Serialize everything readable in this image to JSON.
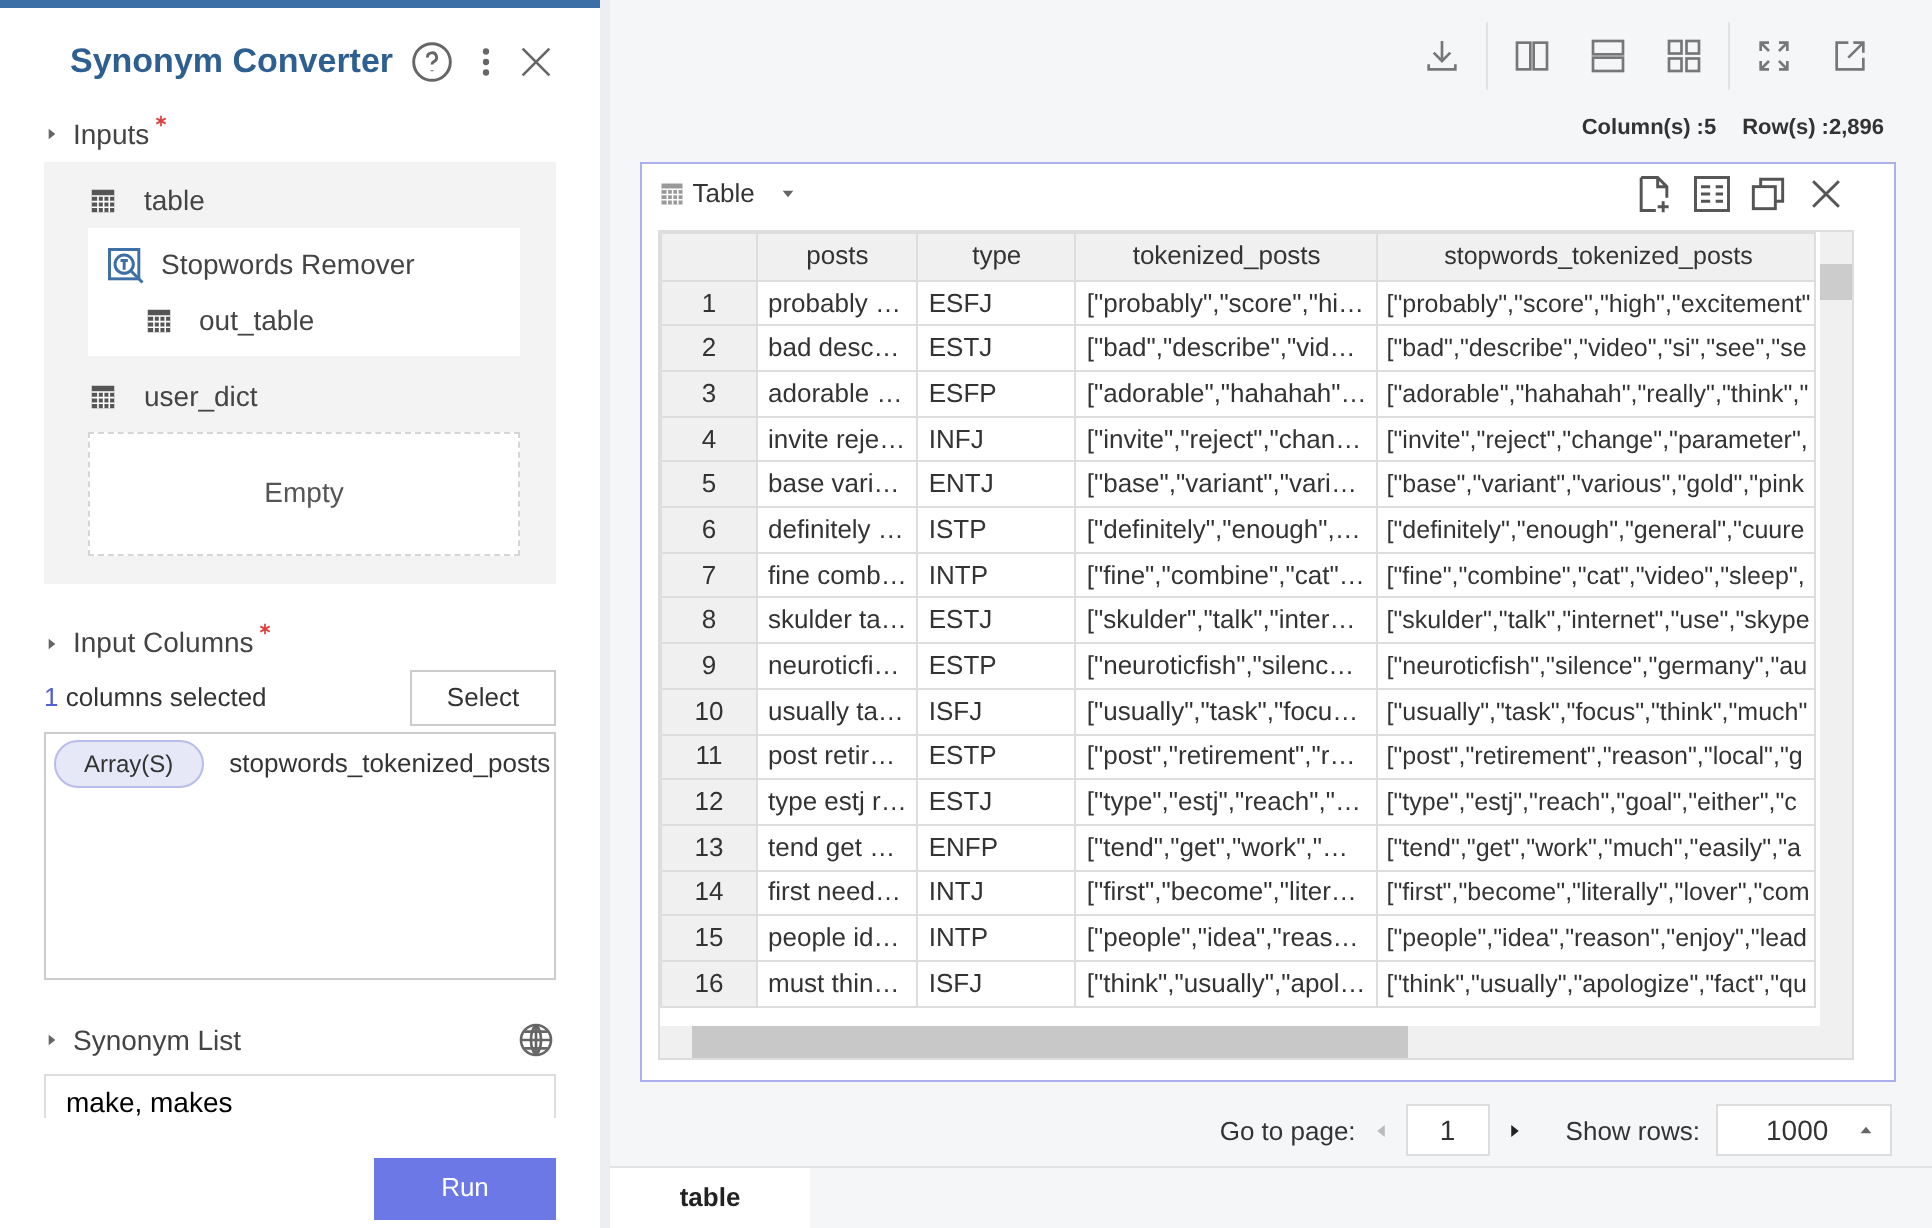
{
  "panel": {
    "title": "Synonym Converter",
    "inputs": {
      "label": "Inputs",
      "required": true,
      "expanded": false,
      "items": [
        {
          "label": "table",
          "children": [
            {
              "kind": "operator",
              "label": "Stopwords Remover",
              "children": [
                {
                  "kind": "table",
                  "label": "out_table"
                }
              ]
            }
          ]
        },
        {
          "label": "user_dict",
          "empty_text": "Empty"
        }
      ]
    },
    "input_columns": {
      "label": "Input Columns",
      "required": true,
      "expanded": false,
      "count": "1",
      "count_text": "columns selected",
      "button": "Select",
      "columns": [
        {
          "type": "Array(S)",
          "name": "stopwords_tokenized_posts"
        }
      ]
    },
    "synonym_list": {
      "label": "Synonym List",
      "required": false,
      "expanded": false,
      "value": "make, makes"
    },
    "run_button": "Run"
  },
  "stats": {
    "columns": "Column(s) :5",
    "rows": "Row(s) :2,896"
  },
  "table_card": {
    "title": "Table",
    "columns": [
      "",
      "posts",
      "type",
      "tokenized_posts",
      "stopwords_tokenized_posts"
    ],
    "rows": [
      [
        "1",
        "probably …",
        "ESFJ",
        "[\"probably\",\"score\",\"hi…",
        "[\"probably\",\"score\",\"high\",\"excitement\""
      ],
      [
        "2",
        "bad desc…",
        "ESTJ",
        "[\"bad\",\"describe\",\"vid…",
        "[\"bad\",\"describe\",\"video\",\"si\",\"see\",\"se"
      ],
      [
        "3",
        "adorable …",
        "ESFP",
        "[\"adorable\",\"hahahah\"…",
        "[\"adorable\",\"hahahah\",\"really\",\"think\",\""
      ],
      [
        "4",
        "invite reje…",
        "INFJ",
        "[\"invite\",\"reject\",\"chan…",
        "[\"invite\",\"reject\",\"change\",\"parameter\","
      ],
      [
        "5",
        "base vari…",
        "ENTJ",
        "[\"base\",\"variant\",\"vari…",
        "[\"base\",\"variant\",\"various\",\"gold\",\"pink"
      ],
      [
        "6",
        "definitely …",
        "ISTP",
        "[\"definitely\",\"enough\",…",
        "[\"definitely\",\"enough\",\"general\",\"cuure"
      ],
      [
        "7",
        "fine comb…",
        "INTP",
        "[\"fine\",\"combine\",\"cat\"…",
        "[\"fine\",\"combine\",\"cat\",\"video\",\"sleep\","
      ],
      [
        "8",
        "skulder ta…",
        "ESTJ",
        "[\"skulder\",\"talk\",\"inter…",
        "[\"skulder\",\"talk\",\"internet\",\"use\",\"skype"
      ],
      [
        "9",
        "neuroticfi…",
        "ESTP",
        "[\"neuroticfish\",\"silenc…",
        "[\"neuroticfish\",\"silence\",\"germany\",\"au"
      ],
      [
        "10",
        "usually ta…",
        "ISFJ",
        "[\"usually\",\"task\",\"focu…",
        "[\"usually\",\"task\",\"focus\",\"think\",\"much\""
      ],
      [
        "11",
        "post retir…",
        "ESTP",
        "[\"post\",\"retirement\",\"r…",
        "[\"post\",\"retirement\",\"reason\",\"local\",\"g"
      ],
      [
        "12",
        "type estj r…",
        "ESTJ",
        "[\"type\",\"estj\",\"reach\",\"…",
        "[\"type\",\"estj\",\"reach\",\"goal\",\"either\",\"c"
      ],
      [
        "13",
        "tend get …",
        "ENFP",
        "[\"tend\",\"get\",\"work\",\"…",
        "[\"tend\",\"get\",\"work\",\"much\",\"easily\",\"a"
      ],
      [
        "14",
        "first need…",
        "INTJ",
        "[\"first\",\"become\",\"liter…",
        "[\"first\",\"become\",\"literally\",\"lover\",\"com"
      ],
      [
        "15",
        "people id…",
        "INTP",
        "[\"people\",\"idea\",\"reas…",
        "[\"people\",\"idea\",\"reason\",\"enjoy\",\"lead"
      ],
      [
        "16",
        "must thin…",
        "ISFJ",
        "[\"think\",\"usually\",\"apol…",
        "[\"think\",\"usually\",\"apologize\",\"fact\",\"qu"
      ]
    ]
  },
  "pagination": {
    "goto_label": "Go to page:",
    "page": "1",
    "rows_label": "Show rows:",
    "rows": "1000"
  },
  "bottom_tabs": [
    {
      "label": "table",
      "selected": true
    }
  ]
}
